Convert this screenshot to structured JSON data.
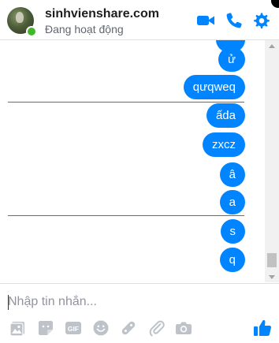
{
  "header": {
    "title": "sinhvienshare.com",
    "status": "Đang hoạt động",
    "accent_color": "#0084ff",
    "icons": [
      "video-call-icon",
      "phone-call-icon",
      "settings-gear-icon"
    ]
  },
  "messages": [
    {
      "text": ""
    },
    {
      "text": "ử"
    },
    {
      "text": "qưqweq"
    },
    {
      "text": "ấda"
    },
    {
      "text": "zxcz"
    },
    {
      "text": "â"
    },
    {
      "text": "a"
    },
    {
      "text": "s"
    },
    {
      "text": "q"
    }
  ],
  "composer": {
    "placeholder": "Nhập tin nhắn...",
    "tools": [
      "photo-icon",
      "sticker-icon",
      "gif-icon",
      "emoji-icon",
      "games-icon",
      "attachment-icon",
      "camera-icon",
      "thumbs-up-icon"
    ],
    "gif_label": "GIF"
  }
}
